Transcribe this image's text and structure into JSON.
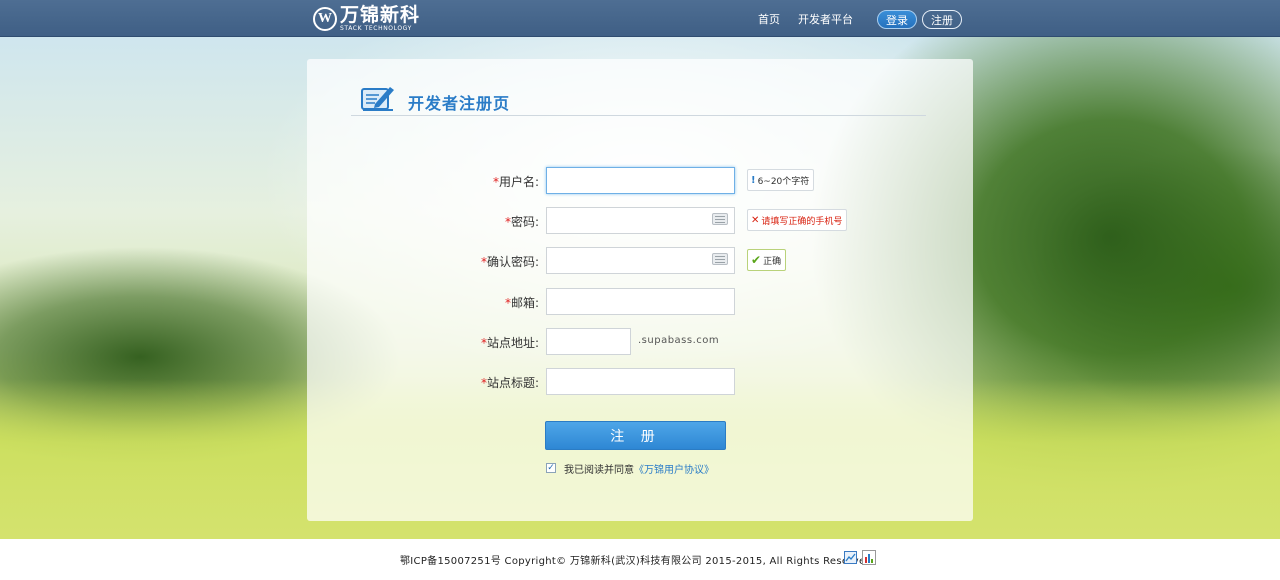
{
  "header": {
    "logo_mark": "W",
    "logo_name": "万锦新科",
    "logo_sub": "STACK TECHNOLOGY",
    "nav": {
      "home": "首页",
      "developer": "开发者平台"
    },
    "login_label": "登录",
    "register_label": "注册"
  },
  "form": {
    "title": "开发者注册页",
    "required_mark": "*",
    "fields": [
      {
        "label": "用户名:",
        "value": "",
        "tip": "6~20个字符",
        "tip_icon": "!"
      },
      {
        "label": "密码:",
        "value": "",
        "tip": "请填写正确的手机号",
        "tip_icon": "✕"
      },
      {
        "label": "确认密码:",
        "value": "",
        "tip": "正确",
        "tip_icon": "✔"
      },
      {
        "label": "邮箱:",
        "value": ""
      },
      {
        "label": "站点地址:",
        "value": "",
        "suffix": ".supabass.com"
      },
      {
        "label": "站点标题:",
        "value": ""
      }
    ],
    "submit_label": "注 册",
    "agree_text": "我已阅读并同意",
    "agree_link": "《万锦用户协议》",
    "agree_checked": "✓"
  },
  "footer": {
    "text": "鄂ICP备15007251号 Copyright© 万锦新科(武汉)科技有限公司 2015-2015, All Rights Reserved."
  },
  "colors": {
    "accent": "#2a7cc7",
    "error": "#d8200f",
    "success": "#5aa51a",
    "topbar": "#46668c"
  }
}
